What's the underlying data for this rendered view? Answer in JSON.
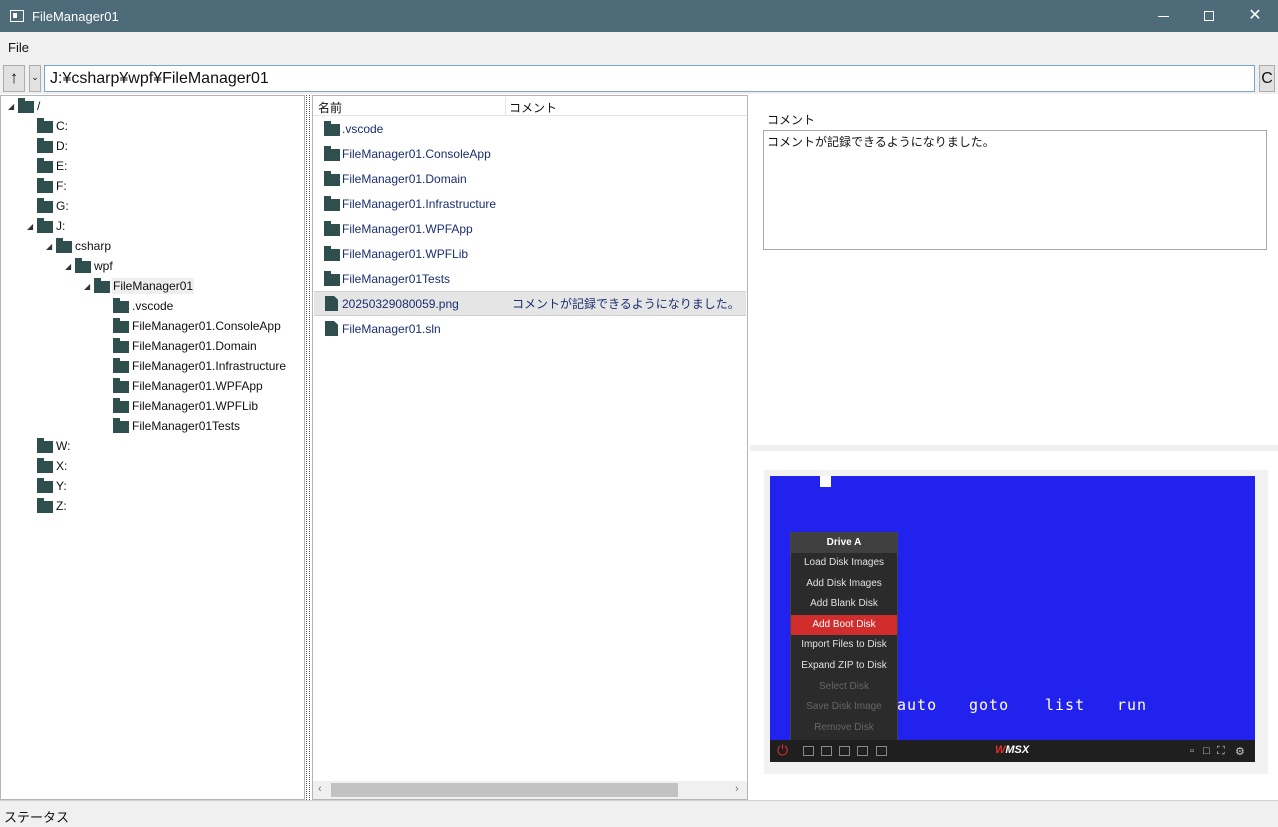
{
  "window": {
    "title": "FileManager01"
  },
  "menu": {
    "file": "File"
  },
  "address": {
    "up": "↑",
    "dropdown": "⌄",
    "path": "J:¥csharp¥wpf¥FileManager01",
    "go": "C"
  },
  "tree": [
    {
      "label": "/",
      "level": 0,
      "expanded": true
    },
    {
      "label": "C:",
      "level": 1
    },
    {
      "label": "D:",
      "level": 1
    },
    {
      "label": "E:",
      "level": 1
    },
    {
      "label": "F:",
      "level": 1
    },
    {
      "label": "G:",
      "level": 1
    },
    {
      "label": "J:",
      "level": 1,
      "expanded": true
    },
    {
      "label": "csharp",
      "level": 2,
      "expanded": true
    },
    {
      "label": "wpf",
      "level": 3,
      "expanded": true
    },
    {
      "label": "FileManager01",
      "level": 4,
      "expanded": true,
      "selected": true
    },
    {
      "label": ".vscode",
      "level": 5
    },
    {
      "label": "FileManager01.ConsoleApp",
      "level": 5
    },
    {
      "label": "FileManager01.Domain",
      "level": 5
    },
    {
      "label": "FileManager01.Infrastructure",
      "level": 5
    },
    {
      "label": "FileManager01.WPFApp",
      "level": 5
    },
    {
      "label": "FileManager01.WPFLib",
      "level": 5
    },
    {
      "label": "FileManager01Tests",
      "level": 5
    },
    {
      "label": "W:",
      "level": 1
    },
    {
      "label": "X:",
      "level": 1
    },
    {
      "label": "Y:",
      "level": 1
    },
    {
      "label": "Z:",
      "level": 1
    }
  ],
  "list": {
    "columns": {
      "name": "名前",
      "comment": "コメント"
    },
    "rows": [
      {
        "name": ".vscode",
        "type": "folder",
        "comment": ""
      },
      {
        "name": "FileManager01.ConsoleApp",
        "type": "folder",
        "comment": ""
      },
      {
        "name": "FileManager01.Domain",
        "type": "folder",
        "comment": ""
      },
      {
        "name": "FileManager01.Infrastructure",
        "type": "folder",
        "comment": ""
      },
      {
        "name": "FileManager01.WPFApp",
        "type": "folder",
        "comment": ""
      },
      {
        "name": "FileManager01.WPFLib",
        "type": "folder",
        "comment": ""
      },
      {
        "name": "FileManager01Tests",
        "type": "folder",
        "comment": ""
      },
      {
        "name": "20250329080059.png",
        "type": "file",
        "comment": "コメントが記録できるようになりました。",
        "selected": true
      },
      {
        "name": "FileManager01.sln",
        "type": "file",
        "comment": ""
      }
    ]
  },
  "detail": {
    "comment_label": "コメント",
    "comment_text": "コメントが記録できるようになりました。"
  },
  "preview": {
    "menu_title": "Drive A",
    "menu_items": [
      {
        "label": "Load Disk Images",
        "state": "normal"
      },
      {
        "label": "Add Disk Images",
        "state": "normal"
      },
      {
        "label": "Add Blank Disk",
        "state": "normal"
      },
      {
        "label": "Add Boot Disk",
        "state": "active"
      },
      {
        "label": "Import Files to Disk",
        "state": "normal"
      },
      {
        "label": "Expand ZIP to Disk",
        "state": "normal"
      },
      {
        "label": "Select Disk",
        "state": "disabled"
      },
      {
        "label": "Save Disk Image",
        "state": "disabled"
      },
      {
        "label": "Remove Disk",
        "state": "disabled"
      }
    ],
    "screen_words": [
      "auto",
      "goto",
      "list",
      "run"
    ],
    "logo_w": "W",
    "logo_text": "MSX",
    "colors": {
      "screen": "#2222ee",
      "active": "#d12d2d"
    }
  },
  "status": {
    "text": "ステータス"
  }
}
